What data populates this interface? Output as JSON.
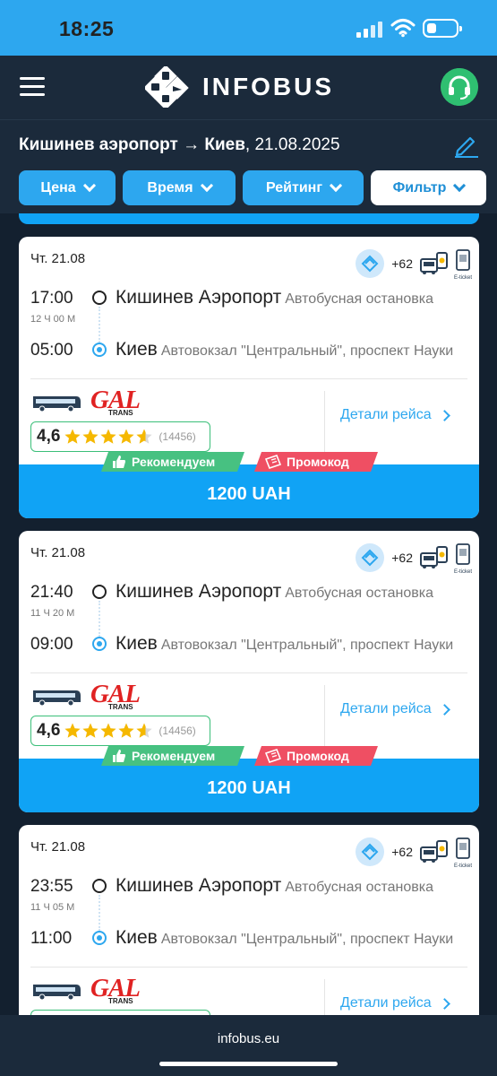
{
  "status": {
    "time": "18:25"
  },
  "header": {
    "brand": "INFOBUS"
  },
  "route": {
    "title_bold": "Кишинев аэропорт → Киев",
    "title_rest": ", 21.08.2025"
  },
  "sort": [
    {
      "label": "Цена"
    },
    {
      "label": "Время"
    },
    {
      "label": "Рейтинг"
    },
    {
      "label": "Фильтр"
    }
  ],
  "trips": [
    {
      "date": "Чт. 21.08",
      "extra_count": "+62",
      "eticket": "E-ticket",
      "dep_time": "17:00",
      "duration": "12 Ч 00 М",
      "dep_city": "Кишинев Аэропорт",
      "dep_stop": "Автобусная остановка",
      "arr_time": "05:00",
      "arr_city": "Киев",
      "arr_stop": "Автовокзал \"Центральный\", проспект Науки",
      "carrier_logo": "GAL",
      "carrier_sub": "TRANS",
      "rating": "4,6",
      "rating_value": 4.6,
      "reviews": "(14456)",
      "details": "Детали рейса",
      "badge_recommend": "Рекомендуем",
      "badge_promo": "Промокод",
      "price": "1200 UAH"
    },
    {
      "date": "Чт. 21.08",
      "extra_count": "+62",
      "eticket": "E-ticket",
      "dep_time": "21:40",
      "duration": "11 Ч 20 М",
      "dep_city": "Кишинев Аэропорт",
      "dep_stop": "Автобусная остановка",
      "arr_time": "09:00",
      "arr_city": "Киев",
      "arr_stop": "Автовокзал \"Центральный\", проспект Науки",
      "carrier_logo": "GAL",
      "carrier_sub": "TRANS",
      "rating": "4,6",
      "rating_value": 4.6,
      "reviews": "(14456)",
      "details": "Детали рейса",
      "badge_recommend": "Рекомендуем",
      "badge_promo": "Промокод",
      "price": "1200 UAH"
    },
    {
      "date": "Чт. 21.08",
      "extra_count": "+62",
      "eticket": "E-ticket",
      "dep_time": "23:55",
      "duration": "11 Ч 05 М",
      "dep_city": "Кишинев Аэропорт",
      "dep_stop": "Автобусная остановка",
      "arr_time": "11:00",
      "arr_city": "Киев",
      "arr_stop": "Автовокзал \"Центральный\", проспект Науки",
      "carrier_logo": "GAL",
      "carrier_sub": "TRANS",
      "details": "Детали рейса"
    }
  ],
  "footer": {
    "url": "infobus.eu"
  },
  "colors": {
    "accent": "#2da7ef",
    "price": "#10a3f5",
    "header": "#1b2a3b",
    "recommend": "#47c181",
    "promo": "#ef4f63",
    "star": "#f5b800"
  }
}
